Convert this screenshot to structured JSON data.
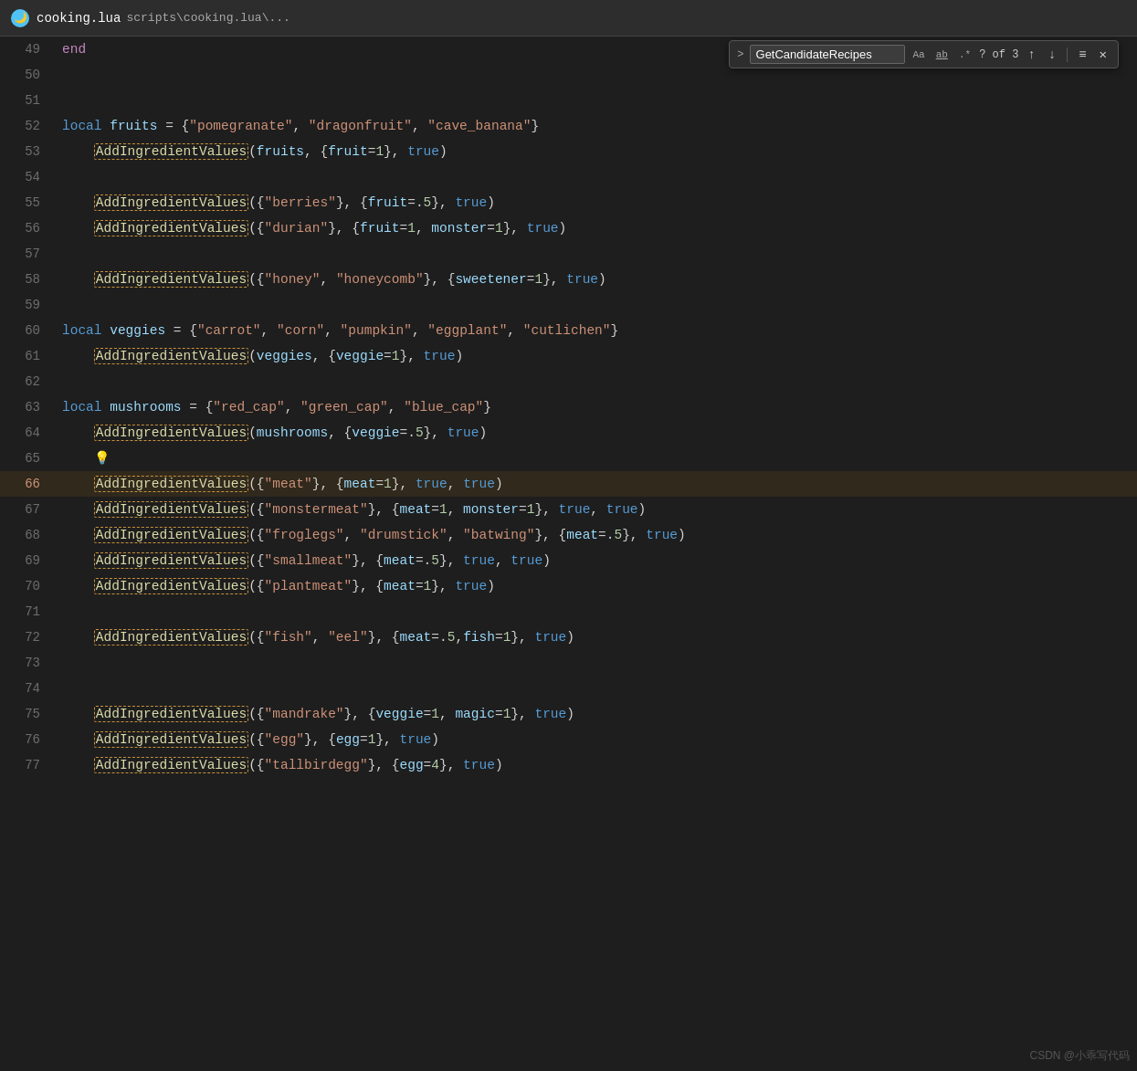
{
  "titleBar": {
    "filename": "cooking.lua",
    "path": "scripts\\cooking.lua\\..."
  },
  "searchBar": {
    "query": "GetCandidateRecipes",
    "optionAa": "Aa",
    "optionAb": "ab",
    "optionRegex": ".*",
    "count": "? of 3",
    "upArrow": "↑",
    "downArrow": "↓",
    "menuIcon": "≡",
    "closeIcon": "✕"
  },
  "lines": [
    {
      "num": 49,
      "content": "end",
      "type": "end"
    },
    {
      "num": 50,
      "content": "",
      "type": "empty"
    },
    {
      "num": 51,
      "content": "",
      "type": "empty"
    },
    {
      "num": 52,
      "content": "local fruits = {\"pomegranate\", \"dragonfruit\", \"cave_banana\"}",
      "type": "var"
    },
    {
      "num": 53,
      "content": "AddIngredientValues(fruits, {fruit=1}, true)",
      "type": "fn"
    },
    {
      "num": 54,
      "content": "",
      "type": "empty"
    },
    {
      "num": 55,
      "content": "AddIngredientValues({\"berries\"}, {fruit=.5}, true)",
      "type": "fn"
    },
    {
      "num": 56,
      "content": "AddIngredientValues({\"durian\"}, {fruit=1, monster=1}, true)",
      "type": "fn"
    },
    {
      "num": 57,
      "content": "",
      "type": "empty"
    },
    {
      "num": 58,
      "content": "AddIngredientValues({\"honey\", \"honeycomb\"}, {sweetener=1}, true)",
      "type": "fn"
    },
    {
      "num": 59,
      "content": "",
      "type": "empty"
    },
    {
      "num": 60,
      "content": "local veggies = {\"carrot\", \"corn\", \"pumpkin\", \"eggplant\", \"cutlichen\"}",
      "type": "var"
    },
    {
      "num": 61,
      "content": "AddIngredientValues(veggies, {veggie=1}, true)",
      "type": "fn"
    },
    {
      "num": 62,
      "content": "",
      "type": "empty"
    },
    {
      "num": 63,
      "content": "local mushrooms = {\"red_cap\", \"green_cap\", \"blue_cap\"}",
      "type": "var"
    },
    {
      "num": 64,
      "content": "AddIngredientValues(mushrooms, {veggie=.5}, true)",
      "type": "fn"
    },
    {
      "num": 65,
      "content": "💡",
      "type": "bulb"
    },
    {
      "num": 66,
      "content": "AddIngredientValues({\"meat\"}, {meat=1}, true, true)",
      "type": "fn",
      "highlighted": true
    },
    {
      "num": 67,
      "content": "AddIngredientValues({\"monstermeat\"}, {meat=1, monster=1}, true, true)",
      "type": "fn"
    },
    {
      "num": 68,
      "content": "AddIngredientValues({\"froglegs\", \"drumstick\", \"batwing\"}, {meat=.5}, true)",
      "type": "fn"
    },
    {
      "num": 69,
      "content": "AddIngredientValues({\"smallmeat\"}, {meat=.5}, true, true)",
      "type": "fn"
    },
    {
      "num": 70,
      "content": "AddIngredientValues({\"plantmeat\"}, {meat=1}, true)",
      "type": "fn"
    },
    {
      "num": 71,
      "content": "",
      "type": "empty"
    },
    {
      "num": 72,
      "content": "AddIngredientValues({\"fish\", \"eel\"}, {meat=.5,fish=1}, true)",
      "type": "fn"
    },
    {
      "num": 73,
      "content": "",
      "type": "empty"
    },
    {
      "num": 74,
      "content": "",
      "type": "empty"
    },
    {
      "num": 75,
      "content": "AddIngredientValues({\"mandrake\"}, {veggie=1, magic=1}, true)",
      "type": "fn"
    },
    {
      "num": 76,
      "content": "AddIngredientValues({\"egg\"}, {egg=1}, true)",
      "type": "fn"
    },
    {
      "num": 77,
      "content": "AddIngredientValues({\"tallbirdegg\"}, {egg=4}, true)",
      "type": "fn"
    }
  ],
  "watermark": "CSDN @小乖写代码"
}
